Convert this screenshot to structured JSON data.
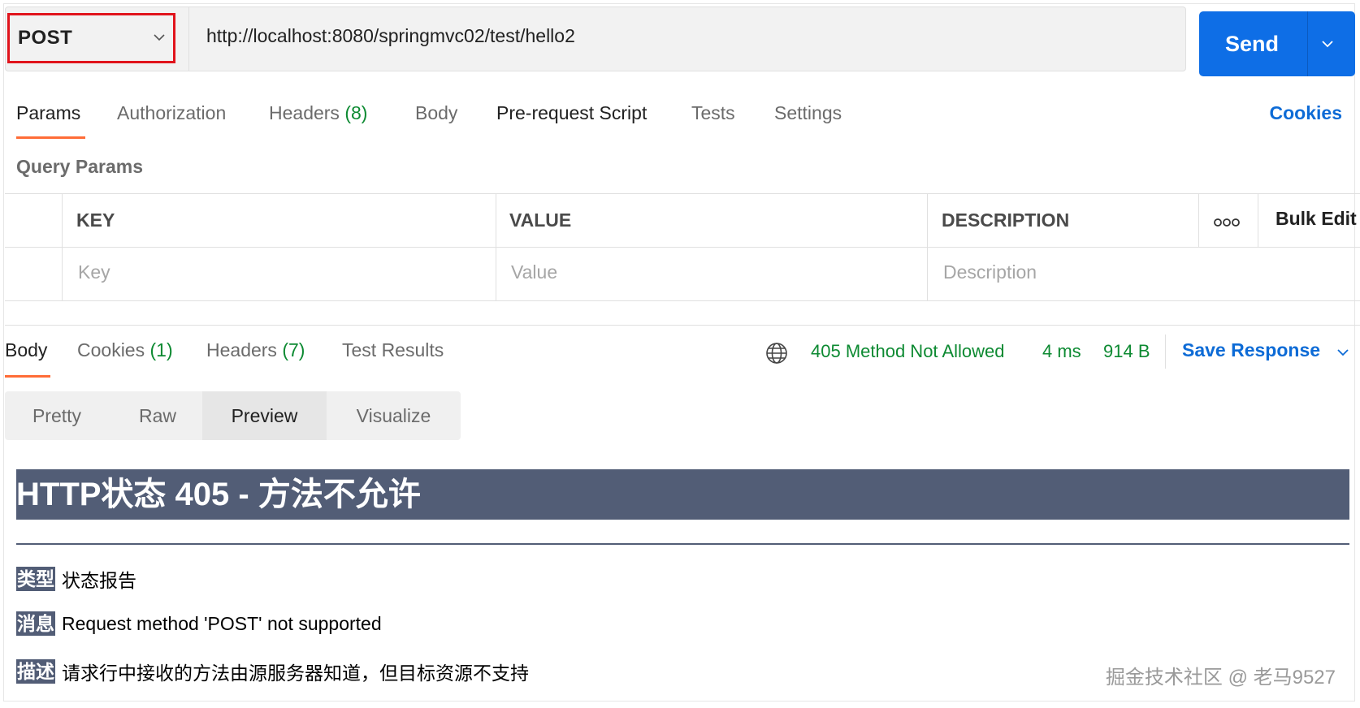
{
  "request": {
    "method": "POST",
    "url": "http://localhost:8080/springmvc02/test/hello2",
    "send_label": "Send"
  },
  "tabs": {
    "params": "Params",
    "authorization": "Authorization",
    "headers": "Headers",
    "headers_count": "(8)",
    "body": "Body",
    "prerequest": "Pre-request Script",
    "tests": "Tests",
    "settings": "Settings",
    "cookies": "Cookies"
  },
  "query_params": {
    "label": "Query Params",
    "columns": {
      "key": "KEY",
      "value": "VALUE",
      "description": "DESCRIPTION"
    },
    "bulk_edit": "Bulk Edit",
    "placeholders": {
      "key": "Key",
      "value": "Value",
      "description": "Description"
    }
  },
  "response": {
    "tabs": {
      "body": "Body",
      "cookies": "Cookies",
      "cookies_count": "(1)",
      "headers": "Headers",
      "headers_count": "(7)",
      "test_results": "Test Results"
    },
    "status": "405 Method Not Allowed",
    "time": "4 ms",
    "size": "914 B",
    "save_label": "Save Response",
    "views": [
      "Pretty",
      "Raw",
      "Preview",
      "Visualize"
    ],
    "active_view": "Preview"
  },
  "preview": {
    "heading": "HTTP状态 405 - 方法不允许",
    "rows": [
      {
        "tag": "类型",
        "text": "状态报告"
      },
      {
        "tag": "消息",
        "text": "Request method 'POST' not supported"
      },
      {
        "tag": "描述",
        "text": "请求行中接收的方法由源服务器知道，但目标资源不支持"
      }
    ]
  },
  "watermark": "掘金技术社区 @ 老马9527",
  "colors": {
    "accent": "#0e6ee6",
    "tab_indicator": "#ff6c37",
    "status_ok_green": "#0d8a32",
    "highlight_border": "#e1141c",
    "tomcat_banner": "#525d76"
  },
  "icons": [
    "chevron-down-icon",
    "more-horizontal-icon",
    "globe-icon"
  ]
}
